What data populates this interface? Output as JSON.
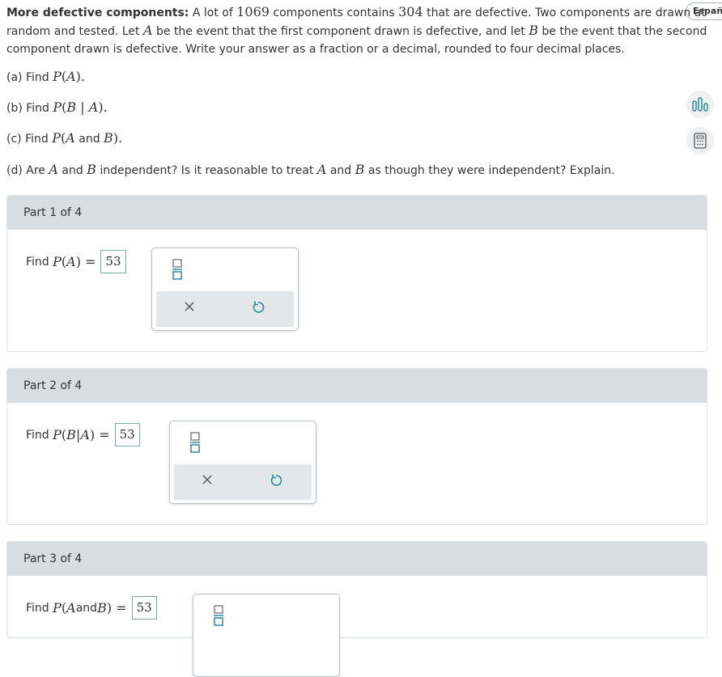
{
  "language_button": "Españo",
  "problem": {
    "lead": "More defective components:",
    "text_1": " A lot of ",
    "n_total": "1069",
    "text_2": " components contains ",
    "n_defective": "304",
    "text_3": " that are defective. Two components are drawn at random and tested. Let ",
    "var_a": "A",
    "text_4": " be the event that the first component drawn is defective, and let ",
    "var_b": "B",
    "text_5": " be the event that the second component drawn is defective. Write your answer as a fraction or a decimal, rounded to four decimal places."
  },
  "questions": {
    "a_prefix": "(a) Find ",
    "b_prefix": "(b) Find ",
    "c_prefix": "(c) Find ",
    "d_prefix": "(d) Are ",
    "d_mid1": " and ",
    "d_mid2": " independent? Is it reasonable to treat ",
    "d_mid3": " and ",
    "d_suffix": " as though they were independent? Explain.",
    "and_word": "and"
  },
  "parts": [
    {
      "header": "Part 1 of 4",
      "find_label": "Find",
      "answer": "53"
    },
    {
      "header": "Part 2 of 4",
      "find_label": "Find",
      "answer": "53"
    },
    {
      "header": "Part 3 of 4",
      "find_label": "Find",
      "answer": "53"
    }
  ],
  "icons": {
    "side_1": "bar-chart-icon",
    "side_2": "calculator-icon",
    "fraction": "fraction-icon",
    "clear": "close-icon",
    "undo": "undo-icon"
  },
  "colors": {
    "teal": "#2b8a9a",
    "header_bg": "#d8dde1"
  }
}
